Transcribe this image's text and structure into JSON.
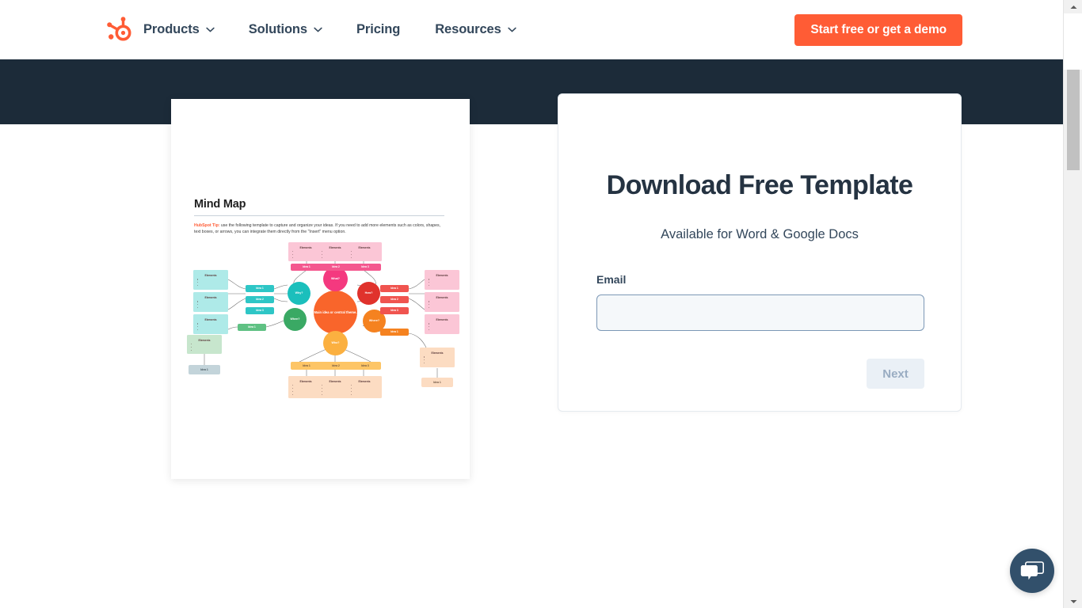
{
  "nav": {
    "logo_icon": "hubspot-sprocket-logo",
    "items": [
      {
        "label": "Products",
        "has_chevron": true
      },
      {
        "label": "Solutions",
        "has_chevron": true
      },
      {
        "label": "Pricing",
        "has_chevron": false
      },
      {
        "label": "Resources",
        "has_chevron": true
      }
    ],
    "cta_label": "Start free or get a demo"
  },
  "preview": {
    "doc_title": "Mind Map",
    "tip_prefix": "HubSpot Tip:",
    "tip_text": " use the following template to capture and organize your ideas. If you need to add more elements such as colors, shapes, text boxes, or arrows, you can integrate them directly from the \"Insert\" menu option.",
    "mindmap": {
      "center_label": "Main idea or central theme.",
      "branches": [
        {
          "question": "What?",
          "color": "#f4397f",
          "ideas": [
            "Idea 1",
            "Idea 2",
            "Idea 3"
          ],
          "elements_label": "Elements"
        },
        {
          "question": "Why?",
          "color": "#1bbfbc",
          "ideas": [
            "Idea 1",
            "Idea 2",
            "Idea 3"
          ],
          "elements_label": "Elements"
        },
        {
          "question": "When?",
          "color": "#3aa964",
          "ideas": [
            "Idea 1"
          ],
          "elements_label": "Elements"
        },
        {
          "question": "Who?",
          "color": "#fbb040",
          "ideas": [
            "Idea 1",
            "Idea 2",
            "Idea 3"
          ],
          "elements_label": "Elements"
        },
        {
          "question": "Where?",
          "color": "#f58220",
          "ideas": [
            "Idea 1"
          ],
          "elements_label": "Elements"
        },
        {
          "question": "How?",
          "color": "#e0322c",
          "ideas": [
            "Idea 1",
            "Idea 2",
            "Idea 3"
          ],
          "elements_label": "Elements"
        }
      ],
      "elements_label": "Elements",
      "idea_labels": [
        "Idea 1",
        "Idea 2",
        "Idea 3"
      ]
    }
  },
  "form": {
    "title": "Download Free Template",
    "subtitle": "Available for Word & Google Docs",
    "email_label": "Email",
    "email_value": "",
    "email_placeholder": "",
    "next_label": "Next"
  },
  "chat": {
    "icon": "chat-bubbles-icon"
  },
  "colors": {
    "brand_orange": "#ff5c35",
    "dark_navy": "#1c2b39",
    "text_navy": "#33475b",
    "heading_navy": "#253342",
    "input_bg": "#f5f8fa",
    "input_border": "#7c98b6",
    "disabled_btn_bg": "#eaf0f6",
    "disabled_btn_text": "#99acc2",
    "chat_bg": "#32506b"
  }
}
